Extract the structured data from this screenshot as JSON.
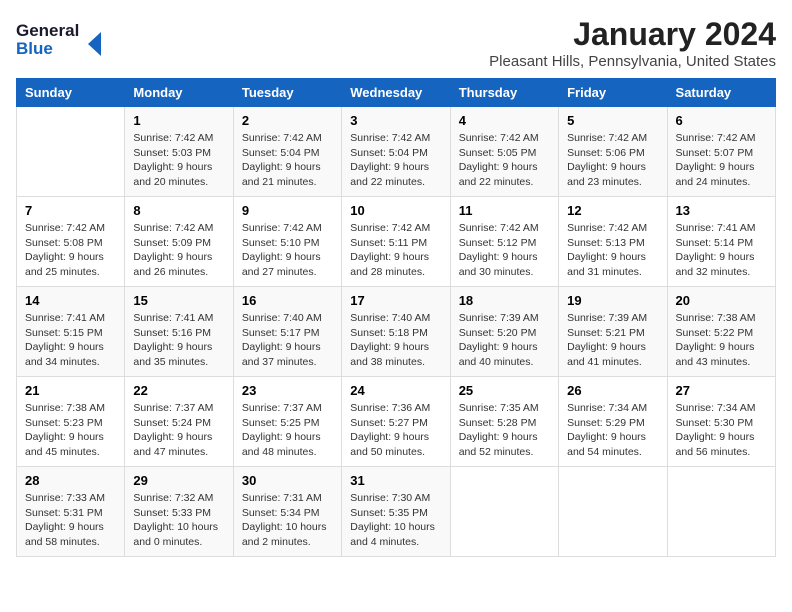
{
  "header": {
    "logo_line1": "General",
    "logo_line2": "Blue",
    "month": "January 2024",
    "location": "Pleasant Hills, Pennsylvania, United States"
  },
  "days_of_week": [
    "Sunday",
    "Monday",
    "Tuesday",
    "Wednesday",
    "Thursday",
    "Friday",
    "Saturday"
  ],
  "weeks": [
    [
      {
        "day": "",
        "sunrise": "",
        "sunset": "",
        "daylight": ""
      },
      {
        "day": "1",
        "sunrise": "Sunrise: 7:42 AM",
        "sunset": "Sunset: 5:03 PM",
        "daylight": "Daylight: 9 hours and 20 minutes."
      },
      {
        "day": "2",
        "sunrise": "Sunrise: 7:42 AM",
        "sunset": "Sunset: 5:04 PM",
        "daylight": "Daylight: 9 hours and 21 minutes."
      },
      {
        "day": "3",
        "sunrise": "Sunrise: 7:42 AM",
        "sunset": "Sunset: 5:04 PM",
        "daylight": "Daylight: 9 hours and 22 minutes."
      },
      {
        "day": "4",
        "sunrise": "Sunrise: 7:42 AM",
        "sunset": "Sunset: 5:05 PM",
        "daylight": "Daylight: 9 hours and 22 minutes."
      },
      {
        "day": "5",
        "sunrise": "Sunrise: 7:42 AM",
        "sunset": "Sunset: 5:06 PM",
        "daylight": "Daylight: 9 hours and 23 minutes."
      },
      {
        "day": "6",
        "sunrise": "Sunrise: 7:42 AM",
        "sunset": "Sunset: 5:07 PM",
        "daylight": "Daylight: 9 hours and 24 minutes."
      }
    ],
    [
      {
        "day": "7",
        "sunrise": "Sunrise: 7:42 AM",
        "sunset": "Sunset: 5:08 PM",
        "daylight": "Daylight: 9 hours and 25 minutes."
      },
      {
        "day": "8",
        "sunrise": "Sunrise: 7:42 AM",
        "sunset": "Sunset: 5:09 PM",
        "daylight": "Daylight: 9 hours and 26 minutes."
      },
      {
        "day": "9",
        "sunrise": "Sunrise: 7:42 AM",
        "sunset": "Sunset: 5:10 PM",
        "daylight": "Daylight: 9 hours and 27 minutes."
      },
      {
        "day": "10",
        "sunrise": "Sunrise: 7:42 AM",
        "sunset": "Sunset: 5:11 PM",
        "daylight": "Daylight: 9 hours and 28 minutes."
      },
      {
        "day": "11",
        "sunrise": "Sunrise: 7:42 AM",
        "sunset": "Sunset: 5:12 PM",
        "daylight": "Daylight: 9 hours and 30 minutes."
      },
      {
        "day": "12",
        "sunrise": "Sunrise: 7:42 AM",
        "sunset": "Sunset: 5:13 PM",
        "daylight": "Daylight: 9 hours and 31 minutes."
      },
      {
        "day": "13",
        "sunrise": "Sunrise: 7:41 AM",
        "sunset": "Sunset: 5:14 PM",
        "daylight": "Daylight: 9 hours and 32 minutes."
      }
    ],
    [
      {
        "day": "14",
        "sunrise": "Sunrise: 7:41 AM",
        "sunset": "Sunset: 5:15 PM",
        "daylight": "Daylight: 9 hours and 34 minutes."
      },
      {
        "day": "15",
        "sunrise": "Sunrise: 7:41 AM",
        "sunset": "Sunset: 5:16 PM",
        "daylight": "Daylight: 9 hours and 35 minutes."
      },
      {
        "day": "16",
        "sunrise": "Sunrise: 7:40 AM",
        "sunset": "Sunset: 5:17 PM",
        "daylight": "Daylight: 9 hours and 37 minutes."
      },
      {
        "day": "17",
        "sunrise": "Sunrise: 7:40 AM",
        "sunset": "Sunset: 5:18 PM",
        "daylight": "Daylight: 9 hours and 38 minutes."
      },
      {
        "day": "18",
        "sunrise": "Sunrise: 7:39 AM",
        "sunset": "Sunset: 5:20 PM",
        "daylight": "Daylight: 9 hours and 40 minutes."
      },
      {
        "day": "19",
        "sunrise": "Sunrise: 7:39 AM",
        "sunset": "Sunset: 5:21 PM",
        "daylight": "Daylight: 9 hours and 41 minutes."
      },
      {
        "day": "20",
        "sunrise": "Sunrise: 7:38 AM",
        "sunset": "Sunset: 5:22 PM",
        "daylight": "Daylight: 9 hours and 43 minutes."
      }
    ],
    [
      {
        "day": "21",
        "sunrise": "Sunrise: 7:38 AM",
        "sunset": "Sunset: 5:23 PM",
        "daylight": "Daylight: 9 hours and 45 minutes."
      },
      {
        "day": "22",
        "sunrise": "Sunrise: 7:37 AM",
        "sunset": "Sunset: 5:24 PM",
        "daylight": "Daylight: 9 hours and 47 minutes."
      },
      {
        "day": "23",
        "sunrise": "Sunrise: 7:37 AM",
        "sunset": "Sunset: 5:25 PM",
        "daylight": "Daylight: 9 hours and 48 minutes."
      },
      {
        "day": "24",
        "sunrise": "Sunrise: 7:36 AM",
        "sunset": "Sunset: 5:27 PM",
        "daylight": "Daylight: 9 hours and 50 minutes."
      },
      {
        "day": "25",
        "sunrise": "Sunrise: 7:35 AM",
        "sunset": "Sunset: 5:28 PM",
        "daylight": "Daylight: 9 hours and 52 minutes."
      },
      {
        "day": "26",
        "sunrise": "Sunrise: 7:34 AM",
        "sunset": "Sunset: 5:29 PM",
        "daylight": "Daylight: 9 hours and 54 minutes."
      },
      {
        "day": "27",
        "sunrise": "Sunrise: 7:34 AM",
        "sunset": "Sunset: 5:30 PM",
        "daylight": "Daylight: 9 hours and 56 minutes."
      }
    ],
    [
      {
        "day": "28",
        "sunrise": "Sunrise: 7:33 AM",
        "sunset": "Sunset: 5:31 PM",
        "daylight": "Daylight: 9 hours and 58 minutes."
      },
      {
        "day": "29",
        "sunrise": "Sunrise: 7:32 AM",
        "sunset": "Sunset: 5:33 PM",
        "daylight": "Daylight: 10 hours and 0 minutes."
      },
      {
        "day": "30",
        "sunrise": "Sunrise: 7:31 AM",
        "sunset": "Sunset: 5:34 PM",
        "daylight": "Daylight: 10 hours and 2 minutes."
      },
      {
        "day": "31",
        "sunrise": "Sunrise: 7:30 AM",
        "sunset": "Sunset: 5:35 PM",
        "daylight": "Daylight: 10 hours and 4 minutes."
      },
      {
        "day": "",
        "sunrise": "",
        "sunset": "",
        "daylight": ""
      },
      {
        "day": "",
        "sunrise": "",
        "sunset": "",
        "daylight": ""
      },
      {
        "day": "",
        "sunrise": "",
        "sunset": "",
        "daylight": ""
      }
    ]
  ]
}
